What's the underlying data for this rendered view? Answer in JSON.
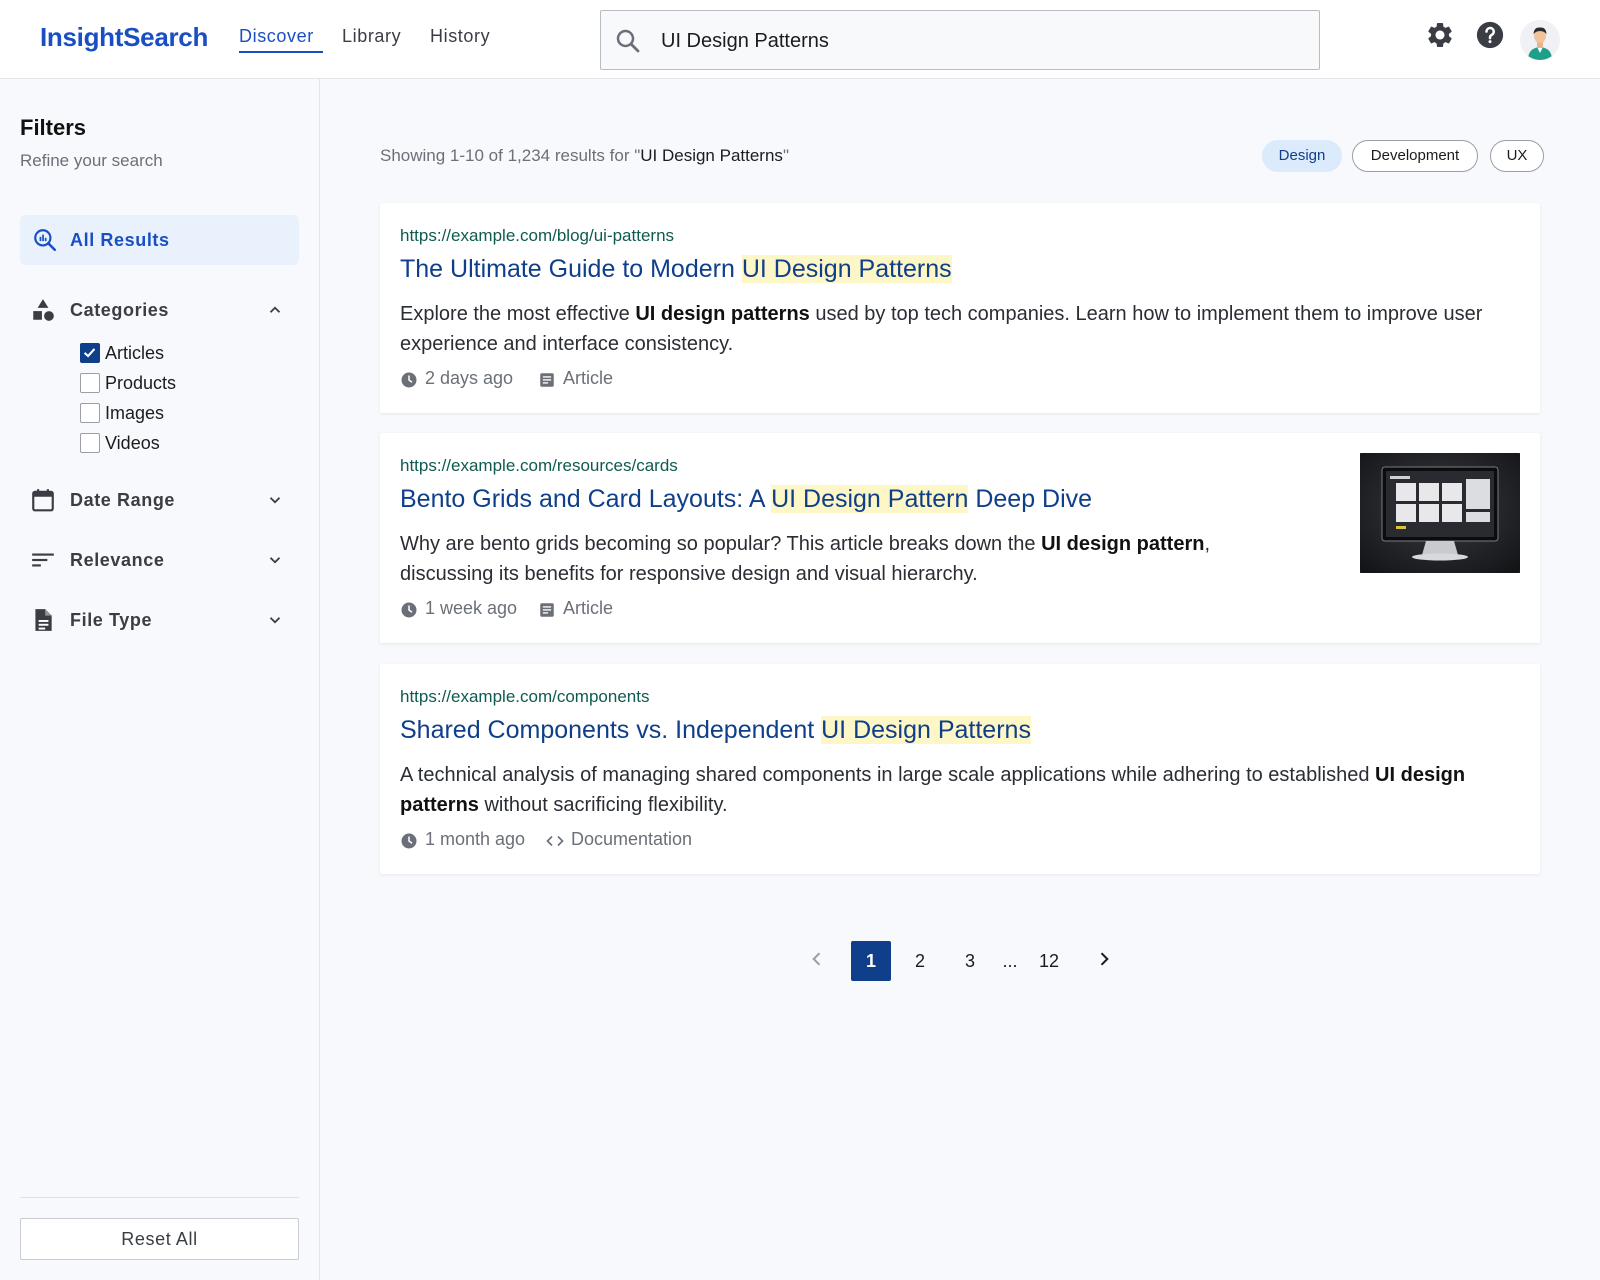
{
  "header": {
    "logo": "InsightSearch",
    "nav": [
      {
        "label": "Discover",
        "active": true
      },
      {
        "label": "Library",
        "active": false
      },
      {
        "label": "History",
        "active": false
      }
    ],
    "search_value": "UI Design Patterns",
    "icons": [
      "search-icon",
      "gear-icon",
      "help-icon",
      "avatar"
    ]
  },
  "sidebar": {
    "title": "Filters",
    "subtitle": "Refine your search",
    "all_results": "All Results",
    "sections": {
      "categories": "Categories",
      "date_range": "Date Range",
      "relevance": "Relevance",
      "file_type": "File Type"
    },
    "categories": [
      {
        "label": "Articles",
        "checked": true
      },
      {
        "label": "Products",
        "checked": false
      },
      {
        "label": "Images",
        "checked": false
      },
      {
        "label": "Videos",
        "checked": false
      }
    ],
    "reset_label": "Reset All"
  },
  "main": {
    "summary_prefix": "Showing 1-10 of 1,234 results for \"",
    "summary_query": "UI Design Patterns",
    "summary_suffix": "\"",
    "chips": [
      {
        "label": "Design",
        "active": true
      },
      {
        "label": "Development",
        "active": false
      },
      {
        "label": "UX",
        "active": false
      }
    ],
    "results": [
      {
        "url": "https://example.com/blog/ui-patterns",
        "title_before": "The Ultimate Guide to Modern ",
        "title_highlight": "UI Design Patterns",
        "title_after": "",
        "snippet_before": "Explore the most effective ",
        "snippet_bold": "UI design patterns",
        "snippet_after": " used by top tech companies. Learn how to implement them to improve user experience and interface consistency.",
        "time": "2 days ago",
        "type": "Article",
        "type_icon": "article-icon"
      },
      {
        "url": "https://example.com/resources/cards",
        "title_before": "Bento Grids and Card Layouts: A ",
        "title_highlight": "UI Design Pattern",
        "title_after": " Deep Dive",
        "snippet_before": "Why are bento grids becoming so popular? This article breaks down the ",
        "snippet_bold": "UI design pattern",
        "snippet_after": ", discussing its benefits for responsive design and visual hierarchy.",
        "time": "1 week ago",
        "type": "Article",
        "type_icon": "article-icon"
      },
      {
        "url": "https://example.com/components",
        "title_before": "Shared Components vs. Independent ",
        "title_highlight": "UI Design Patterns",
        "title_after": "",
        "snippet_before": "A technical analysis of managing shared components in large scale applications while adhering to established ",
        "snippet_bold": "UI design patterns",
        "snippet_after": " without sacrificing flexibility.",
        "time": "1 month ago",
        "type": "Documentation",
        "type_icon": "code-icon"
      }
    ]
  },
  "pagination": {
    "pages": [
      "1",
      "2",
      "3"
    ],
    "ellipsis": "...",
    "last": "12",
    "current": "1"
  },
  "colors": {
    "brand": "#1a4fc4",
    "title": "#0f3f8a",
    "url": "#0e5a4f",
    "highlight": "#fdf6c6"
  }
}
